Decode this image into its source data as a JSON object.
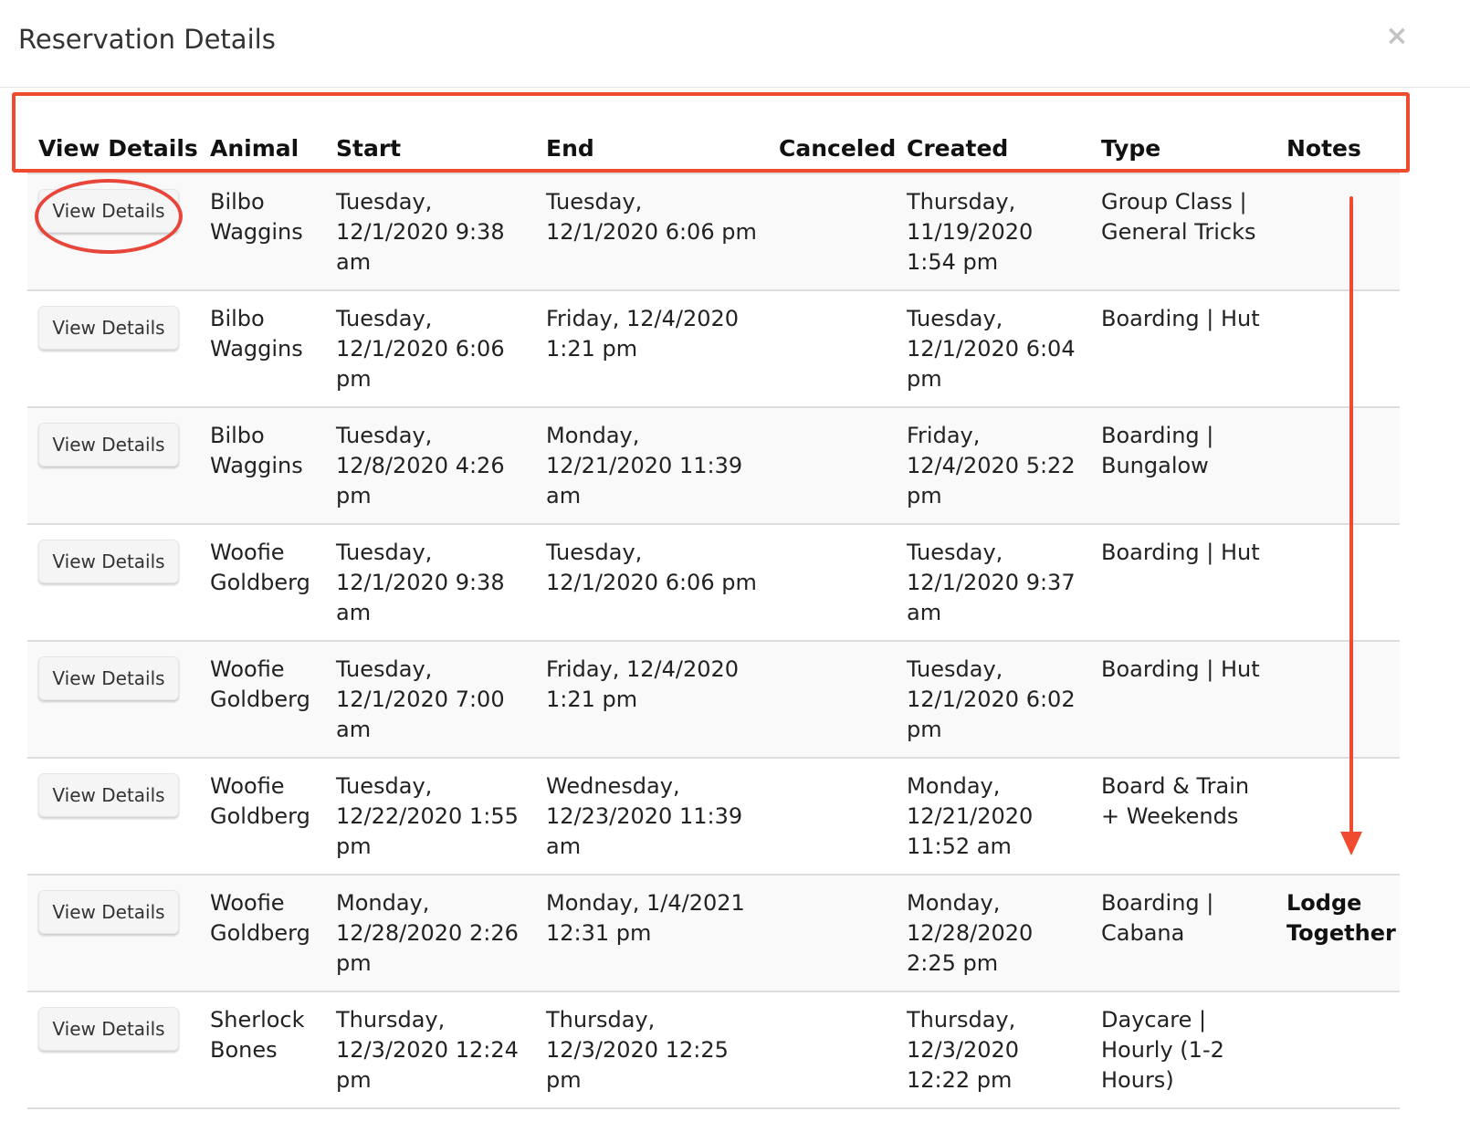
{
  "modal": {
    "title": "Reservation Details",
    "close_label": "×"
  },
  "table": {
    "columns": [
      "View Details",
      "Animal",
      "Start",
      "End",
      "Canceled",
      "Created",
      "Type",
      "Notes"
    ],
    "button_label": "View Details",
    "rows": [
      {
        "animal": "Bilbo Waggins",
        "start": "Tuesday, 12/1/2020 9:38 am",
        "end": "Tuesday, 12/1/2020 6:06 pm",
        "canceled": "",
        "created": "Thursday, 11/19/2020 1:54 pm",
        "type": "Group Class | General Tricks",
        "notes": ""
      },
      {
        "animal": "Bilbo Waggins",
        "start": "Tuesday, 12/1/2020 6:06 pm",
        "end": "Friday, 12/4/2020 1:21 pm",
        "canceled": "",
        "created": "Tuesday, 12/1/2020 6:04 pm",
        "type": "Boarding | Hut",
        "notes": ""
      },
      {
        "animal": "Bilbo Waggins",
        "start": "Tuesday, 12/8/2020 4:26 pm",
        "end": "Monday, 12/21/2020 11:39 am",
        "canceled": "",
        "created": "Friday, 12/4/2020 5:22 pm",
        "type": "Boarding | Bungalow",
        "notes": ""
      },
      {
        "animal": "Woofie Goldberg",
        "start": "Tuesday, 12/1/2020 9:38 am",
        "end": "Tuesday, 12/1/2020 6:06 pm",
        "canceled": "",
        "created": "Tuesday, 12/1/2020 9:37 am",
        "type": "Boarding | Hut",
        "notes": ""
      },
      {
        "animal": "Woofie Goldberg",
        "start": "Tuesday, 12/1/2020 7:00 am",
        "end": "Friday, 12/4/2020 1:21 pm",
        "canceled": "",
        "created": "Tuesday, 12/1/2020 6:02 pm",
        "type": "Boarding | Hut",
        "notes": ""
      },
      {
        "animal": "Woofie Goldberg",
        "start": "Tuesday, 12/22/2020 1:55 pm",
        "end": "Wednesday, 12/23/2020 11:39 am",
        "canceled": "",
        "created": "Monday, 12/21/2020 11:52 am",
        "type": "Board & Train + Weekends",
        "notes": ""
      },
      {
        "animal": "Woofie Goldberg",
        "start": "Monday, 12/28/2020 2:26 pm",
        "end": "Monday, 1/4/2021 12:31 pm",
        "canceled": "",
        "created": "Monday, 12/28/2020 2:25 pm",
        "type": "Boarding | Cabana",
        "notes": "Lodge Together"
      },
      {
        "animal": "Sherlock Bones",
        "start": "Thursday, 12/3/2020 12:24 pm",
        "end": "Thursday, 12/3/2020 12:25 pm",
        "canceled": "",
        "created": "Thursday, 12/3/2020 12:22 pm",
        "type": "Daycare | Hourly (1-2 Hours)",
        "notes": ""
      }
    ]
  },
  "annotations": {
    "color": "#f04b2e"
  }
}
